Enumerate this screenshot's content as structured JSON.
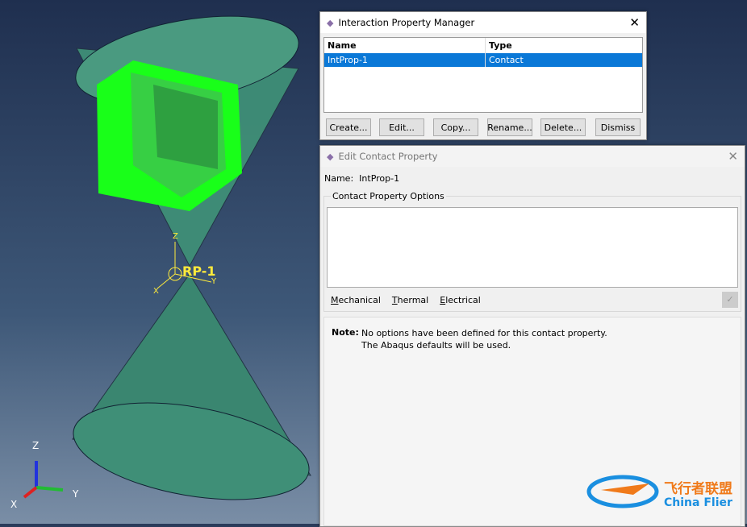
{
  "viewport": {
    "rp_label": "RP-1",
    "triad_local": {
      "z": "Z",
      "x": "X",
      "y": "Y"
    },
    "triad_global": {
      "z": "Z",
      "x": "X",
      "y": "Y"
    },
    "colors": {
      "part": "#3f8f77",
      "selected": "#19ff19",
      "background": "#2a3b5a"
    }
  },
  "manager": {
    "title": "Interaction Property Manager",
    "columns": [
      "Name",
      "Type"
    ],
    "rows": [
      {
        "name": "IntProp-1",
        "type": "Contact",
        "selected": true
      }
    ],
    "buttons": [
      "Create...",
      "Edit...",
      "Copy...",
      "Rename...",
      "Delete...",
      "Dismiss"
    ],
    "selection_color": "#0a78d7"
  },
  "editor": {
    "title": "Edit Contact Property",
    "name_label": "Name:",
    "name_value": "IntProp-1",
    "group_label": "Contact Property Options",
    "menus": [
      {
        "mnemonic": "M",
        "rest": "echanical"
      },
      {
        "mnemonic": "T",
        "rest": "hermal"
      },
      {
        "mnemonic": "E",
        "rest": "lectrical"
      }
    ],
    "note_label": "Note:",
    "note_lines": [
      "No options have been defined for this contact property.",
      "The Abaqus defaults will be used."
    ]
  },
  "watermark": {
    "cn": "飞行者联盟",
    "en": "China Flier"
  }
}
